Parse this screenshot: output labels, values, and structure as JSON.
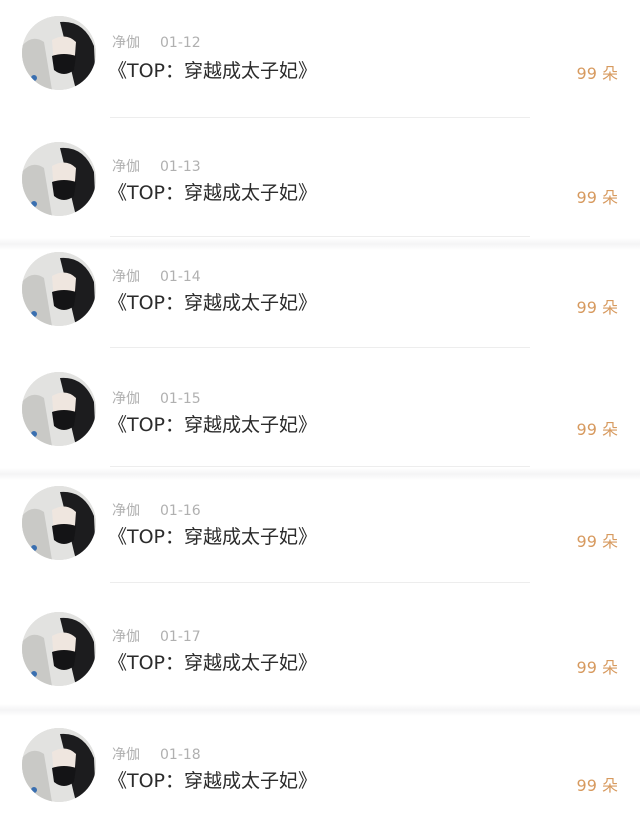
{
  "accent_color": "#d79a5f",
  "messages": [
    {
      "user": "净伽",
      "date": "01-12",
      "title": "《TOP：穿越成太子妃》",
      "gift": "99 朵",
      "avatar": "avatar-photo"
    },
    {
      "user": "净伽",
      "date": "01-13",
      "title": "《TOP：穿越成太子妃》",
      "gift": "99 朵",
      "avatar": "avatar-photo"
    },
    {
      "user": "净伽",
      "date": "01-14",
      "title": "《TOP：穿越成太子妃》",
      "gift": "99 朵",
      "avatar": "avatar-photo"
    },
    {
      "user": "净伽",
      "date": "01-15",
      "title": "《TOP：穿越成太子妃》",
      "gift": "99 朵",
      "avatar": "avatar-photo"
    },
    {
      "user": "净伽",
      "date": "01-16",
      "title": "《TOP：穿越成太子妃》",
      "gift": "99 朵",
      "avatar": "avatar-photo"
    },
    {
      "user": "净伽",
      "date": "01-17",
      "title": "《TOP：穿越成太子妃》",
      "gift": "99 朵",
      "avatar": "avatar-photo"
    },
    {
      "user": "净伽",
      "date": "01-18",
      "title": "《TOP：穿越成太子妃》",
      "gift": "99 朵",
      "avatar": "avatar-photo"
    }
  ]
}
